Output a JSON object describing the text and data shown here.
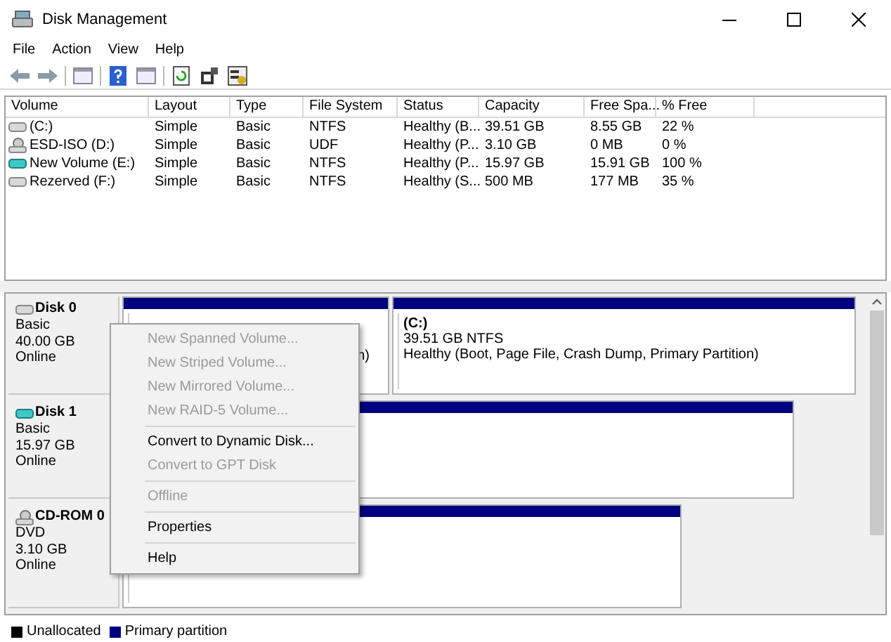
{
  "window": {
    "title": "Disk Management"
  },
  "menu_bar": [
    "File",
    "Action",
    "View",
    "Help"
  ],
  "table": {
    "columns": [
      "Volume",
      "Layout",
      "Type",
      "File System",
      "Status",
      "Capacity",
      "Free Spa...",
      "% Free"
    ],
    "rows": [
      {
        "kind": "hdd",
        "cells": [
          "(C:)",
          "Simple",
          "Basic",
          "NTFS",
          "Healthy (B...",
          "39.51 GB",
          "8.55 GB",
          "22 %"
        ]
      },
      {
        "kind": "cd",
        "cells": [
          "ESD-ISO (D:)",
          "Simple",
          "Basic",
          "UDF",
          "Healthy (P...",
          "3.10 GB",
          "0 MB",
          "0 %"
        ]
      },
      {
        "kind": "usb",
        "cells": [
          "New Volume (E:)",
          "Simple",
          "Basic",
          "NTFS",
          "Healthy (P...",
          "15.97 GB",
          "15.91 GB",
          "100 %"
        ]
      },
      {
        "kind": "hdd",
        "cells": [
          "Rezerved (F:)",
          "Simple",
          "Basic",
          "NTFS",
          "Healthy (S...",
          "500 MB",
          "177 MB",
          "35 %"
        ]
      }
    ]
  },
  "disks": [
    {
      "kind": "hdd",
      "name": "Disk 0",
      "lines": [
        "Basic",
        "40.00 GB",
        "Online"
      ],
      "partitions": [
        {
          "kind": "primary",
          "lines": [
            "n)"
          ]
        },
        {
          "kind": "primary",
          "title": "(C:)",
          "lines": [
            "39.51 GB NTFS",
            "Healthy (Boot, Page File, Crash Dump, Primary Partition)"
          ]
        }
      ]
    },
    {
      "kind": "usb",
      "name": "Disk 1",
      "lines": [
        "Basic",
        "15.97 GB",
        "Online"
      ],
      "partitions": [
        {
          "kind": "primary"
        }
      ]
    },
    {
      "kind": "cd",
      "name": "CD-ROM 0",
      "lines": [
        "DVD",
        "3.10 GB",
        "Online"
      ],
      "partitions": [
        {
          "kind": "primary"
        }
      ]
    }
  ],
  "context_menu": [
    {
      "label": "New Spanned Volume...",
      "disabled": true
    },
    {
      "label": "New Striped Volume...",
      "disabled": true
    },
    {
      "label": "New Mirrored Volume...",
      "disabled": true
    },
    {
      "label": "New RAID-5 Volume...",
      "disabled": true,
      "separator_after": true
    },
    {
      "label": "Convert to Dynamic Disk...",
      "disabled": false
    },
    {
      "label": "Convert to GPT Disk",
      "disabled": true,
      "separator_after": true
    },
    {
      "label": "Offline",
      "disabled": true,
      "separator_after": true
    },
    {
      "label": "Properties",
      "disabled": false,
      "separator_after": true
    },
    {
      "label": "Help",
      "disabled": false
    }
  ],
  "legend": [
    {
      "label": "Unallocated",
      "color": "#000000"
    },
    {
      "label": "Primary partition",
      "color": "#000080"
    }
  ]
}
